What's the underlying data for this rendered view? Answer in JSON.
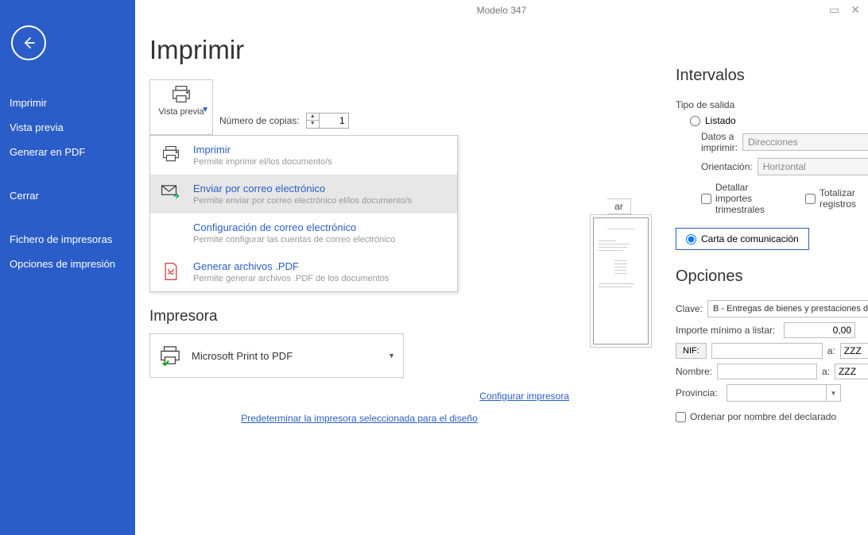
{
  "window_title": "Modelo 347",
  "sidebar": {
    "items": [
      {
        "label": "Imprimir"
      },
      {
        "label": "Vista previa"
      },
      {
        "label": "Generar en PDF"
      },
      {
        "label": "Cerrar"
      },
      {
        "label": "Fichero de impresoras"
      },
      {
        "label": "Opciones de impresión"
      }
    ]
  },
  "main": {
    "title": "Imprimir",
    "preview_button": "Vista previa",
    "copies_label": "Número de copias:",
    "copies_value": "1",
    "menu": [
      {
        "title": "Imprimir",
        "desc": "Permite imprimir el/los documento/s"
      },
      {
        "title": "Enviar por correo electrónico",
        "desc": "Permite enviar por correo electrónico el/los documento/s"
      },
      {
        "title": "Configuración de correo electrónico",
        "desc": "Permite configurar las cuentas de correo electrónico"
      },
      {
        "title": "Generar archivos .PDF",
        "desc": "Permite generar archivos .PDF de los documentos"
      }
    ],
    "tab_fragment": "ar",
    "impresora_heading": "Impresora",
    "printer_name": "Microsoft Print to PDF",
    "link_config": "Configurar impresora",
    "link_default": "Predeterminar la impresora seleccionada para el diseño"
  },
  "right": {
    "intervalos_heading": "Intervalos",
    "tipo_salida_label": "Tipo de salida",
    "radio_listado": "Listado",
    "datos_imprimir_label": "Datos a imprimir:",
    "datos_imprimir_value": "Direcciones",
    "orientacion_label": "Orientación:",
    "orientacion_value": "Horizontal",
    "chk_detallar": "Detallar importes trimestrales",
    "chk_totalizar": "Totalizar registros",
    "radio_carta": "Carta de comunicación",
    "opciones_heading": "Opciones",
    "clave_label": "Clave:",
    "clave_value": "B - Entregas de bienes y prestaciones de servicios superiore",
    "importe_label": "Importe mínimo a listar:",
    "importe_value": "0,00",
    "nif_btn": "NIF:",
    "a_label": "a:",
    "nif_to": "ZZZ",
    "nombre_label": "Nombre:",
    "nombre_to": "ZZZ",
    "provincia_label": "Provincia:",
    "chk_ordenar": "Ordenar por nombre del declarado"
  }
}
